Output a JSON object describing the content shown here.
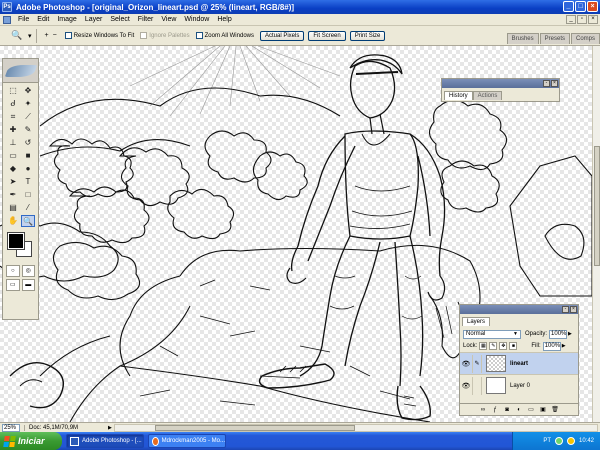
{
  "window": {
    "title": "Adobe Photoshop - [original_Orizon_lineart.psd @ 25% (lineart, RGB/8#)]",
    "logo_text": "Ps"
  },
  "menu": {
    "items": [
      "File",
      "Edit",
      "Image",
      "Layer",
      "Select",
      "Filter",
      "View",
      "Window",
      "Help"
    ]
  },
  "options": {
    "zoom_in_symbol": "+",
    "zoom_out_symbol": "−",
    "resize_windows": "Resize Windows To Fit",
    "ignore_palettes": "Ignore Palettes",
    "zoom_all_windows": "Zoom All Windows",
    "actual_pixels": "Actual Pixels",
    "fit_screen": "Fit Screen",
    "print_size": "Print Size"
  },
  "palette_well": {
    "tabs": [
      "Brushes",
      "Presets",
      "Comps"
    ]
  },
  "history_panel": {
    "tabs": [
      "History",
      "Actions"
    ]
  },
  "layers_panel": {
    "tab": "Layers",
    "blend_mode": "Normal",
    "opacity_label": "Opacity:",
    "opacity_value": "100%",
    "lock_label": "Lock:",
    "fill_label": "Fill:",
    "fill_value": "100%",
    "layers": [
      {
        "name": "lineart",
        "selected": true
      },
      {
        "name": "Layer 0",
        "selected": false
      }
    ]
  },
  "status": {
    "zoom": "25%",
    "doc": "Doc: 45,1M/70,9M"
  },
  "taskbar": {
    "start": "Iniciar",
    "tasks": [
      "Adobe Photoshop - [...",
      "Mdrockman2005 - Mo..."
    ],
    "lang": "PT",
    "clock": "10:42"
  },
  "colors": {
    "title_blue": "#0a3fc4",
    "taskbar_blue": "#2458d8",
    "start_green": "#3a9a32",
    "foreground": "#000000",
    "background": "#ffffff"
  }
}
